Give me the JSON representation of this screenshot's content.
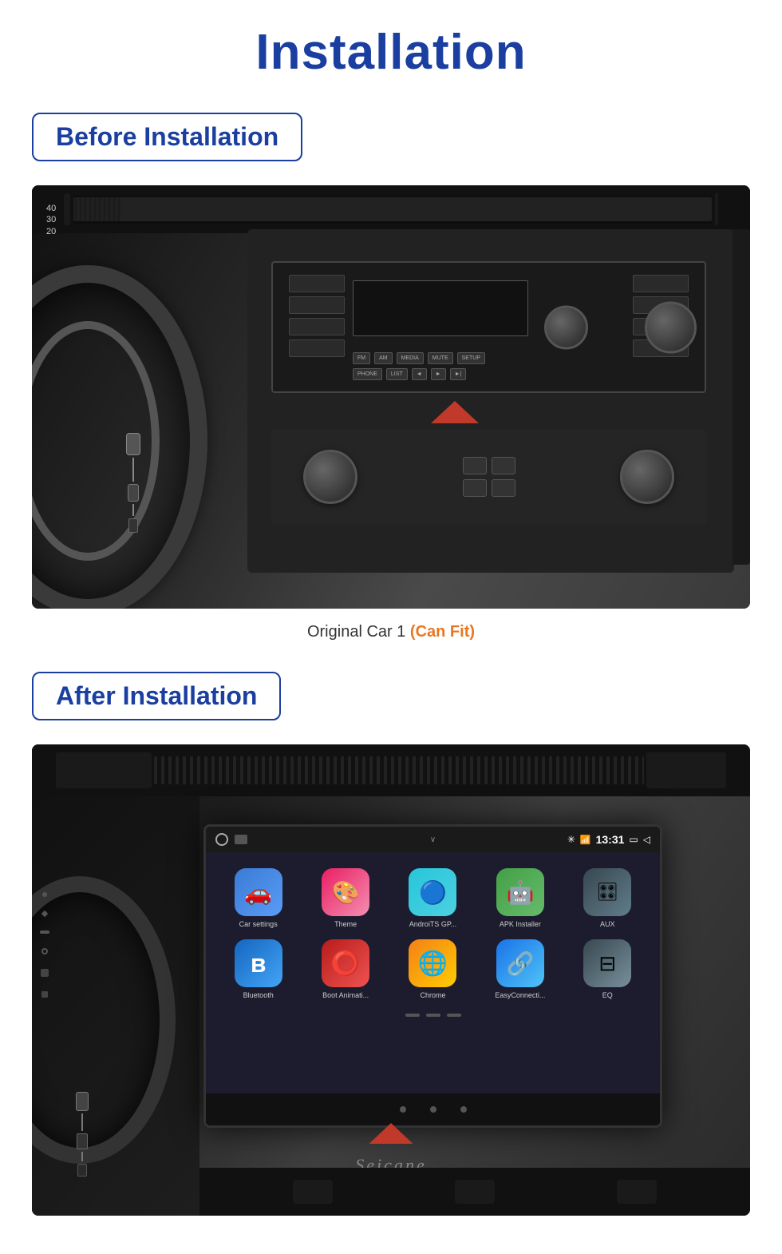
{
  "page": {
    "title": "Installation",
    "background_color": "#ffffff"
  },
  "before_section": {
    "label": "Before Installation",
    "image_alt": "Car interior before installation - original radio",
    "caption_main": "Original Car  1",
    "caption_highlight": "(Can Fit)",
    "caption_highlight_color": "#e87722"
  },
  "after_section": {
    "label": "After Installation",
    "image_alt": "Car interior after installation - Android head unit"
  },
  "android_screen": {
    "status_bar": {
      "time": "13:31",
      "icons": [
        "bluetooth",
        "signal",
        "battery",
        "screen"
      ]
    },
    "apps_row1": [
      {
        "label": "Car settings",
        "color_class": "app-car",
        "icon": "🚗"
      },
      {
        "label": "Theme",
        "color_class": "app-theme",
        "icon": "🎨"
      },
      {
        "label": "AndroiTS GP...",
        "color_class": "app-android",
        "icon": "🔵"
      },
      {
        "label": "APK Installer",
        "color_class": "app-apk",
        "icon": "🤖"
      },
      {
        "label": "AUX",
        "color_class": "app-aux",
        "icon": "🎛"
      }
    ],
    "apps_row2": [
      {
        "label": "Bluetooth",
        "color_class": "app-bt",
        "icon": "🔷"
      },
      {
        "label": "Boot Animati...",
        "color_class": "app-boot",
        "icon": "⭕"
      },
      {
        "label": "Chrome",
        "color_class": "app-chrome",
        "icon": "🌐"
      },
      {
        "label": "EasyConnecti...",
        "color_class": "app-easy",
        "icon": "🔗"
      },
      {
        "label": "EQ",
        "color_class": "app-eq",
        "icon": "📊"
      }
    ]
  },
  "brand": {
    "name": "Seicane"
  }
}
